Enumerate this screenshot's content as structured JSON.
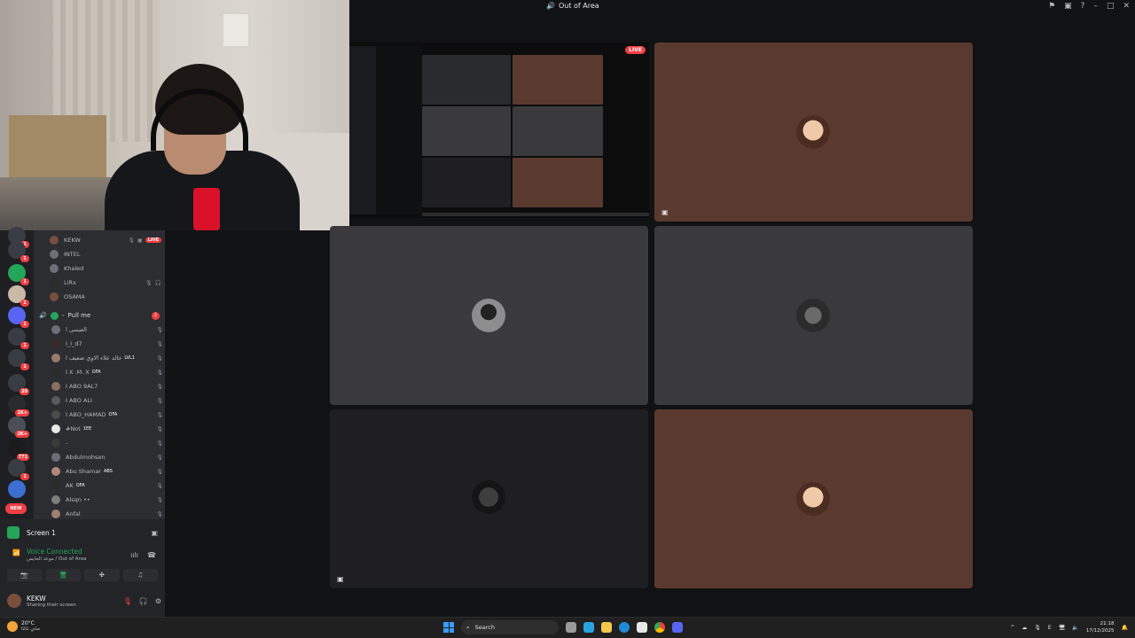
{
  "window": {
    "title": "Out of Area"
  },
  "channels": {
    "rows_top": [
      {
        "name": "KEKW",
        "live": "LIVE"
      },
      {
        "name": "INTEL"
      },
      {
        "name": "Khaled"
      },
      {
        "name": "LiRx"
      },
      {
        "name": "OSAMA"
      }
    ],
    "voice_channel": {
      "name": "Pull me",
      "count": "1"
    },
    "members": [
      {
        "name": "العيسى ا",
        "tag": ""
      },
      {
        "name": "I_I_d7",
        "tag": ""
      },
      {
        "name": "خالد علاء الاوي ضعيف ا",
        "tag": "LVL1"
      },
      {
        "name": "I X .M. X",
        "tag": "OFA"
      },
      {
        "name": "I ABO 9AL7",
        "tag": ""
      },
      {
        "name": "I ABO ALI",
        "tag": ""
      },
      {
        "name": "I ABO_HAMAD",
        "tag": "OFA"
      },
      {
        "name": "#Not",
        "tag": "1EE"
      },
      {
        "name": "-",
        "tag": ""
      },
      {
        "name": "Abdulmohsen",
        "tag": ""
      },
      {
        "name": "Abu Shamar",
        "tag": "ABS"
      },
      {
        "name": "AK",
        "tag": "OFA"
      },
      {
        "name": "Alsqn ••",
        "tag": ""
      },
      {
        "name": "Anfal",
        "tag": ""
      }
    ]
  },
  "rail": {
    "badges": [
      "1",
      "1",
      "1",
      "1",
      "1",
      "1",
      "20",
      "1K+",
      "2K+",
      "771",
      "1",
      "NEW"
    ]
  },
  "panel": {
    "screen_label": "Screen 1",
    "voice_status": "Voice Connected",
    "voice_location": "موعد الحايس / Out of Area",
    "user_name": "KEKW",
    "user_status": "Sharing their screen"
  },
  "tiles": {
    "live_label": "LIVE"
  },
  "taskbar": {
    "weather_temp": "20°C",
    "weather_desc": "صافٍ غالبًا",
    "search_placeholder": "Search",
    "lang": "E",
    "time": "21:18",
    "date": "17/12/2025"
  },
  "colors": {
    "live": "#f23f43",
    "green": "#23a55a",
    "brown_tile": "#5a3a2e",
    "grey_tile": "#3a3a3c"
  }
}
